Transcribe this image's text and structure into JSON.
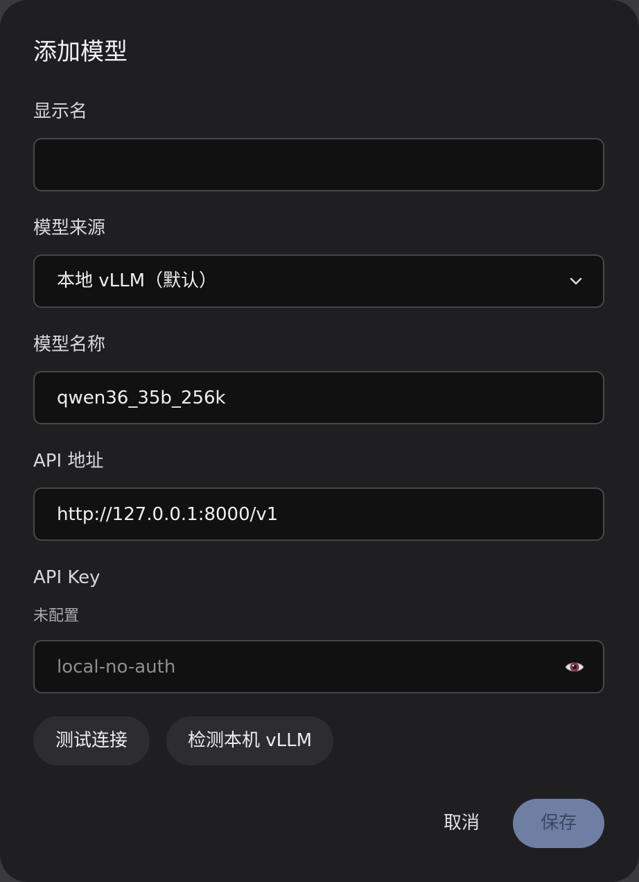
{
  "dialog": {
    "title": "添加模型"
  },
  "fields": {
    "display_name": {
      "label": "显示名",
      "value": "",
      "placeholder": ""
    },
    "source": {
      "label": "模型来源",
      "selected": "本地 vLLM（默认）",
      "icon": "chevron-down-icon"
    },
    "model_name": {
      "label": "模型名称",
      "value": "qwen36_35b_256k"
    },
    "api_url": {
      "label": "API 地址",
      "value": "http://127.0.0.1:8000/v1"
    },
    "api_key": {
      "label": "API Key",
      "status": "未配置",
      "placeholder": "local-no-auth",
      "icon": "eye-icon"
    }
  },
  "actions": {
    "test_connection": "测试连接",
    "detect_local": "检测本机 vLLM",
    "cancel": "取消",
    "save": "保存"
  },
  "colors": {
    "dialog_bg": "#1f1f21",
    "input_bg": "#111112",
    "input_border": "#48484c",
    "pill_bg": "#2d2d30",
    "save_bg": "#6f7fa4",
    "save_text": "#3b4660"
  }
}
